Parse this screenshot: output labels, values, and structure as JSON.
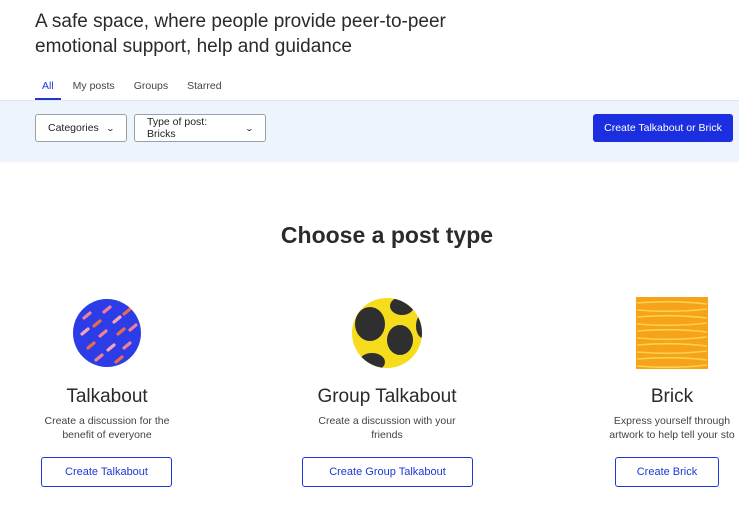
{
  "headline": "A safe space, where people provide peer-to-peer emotional support, help and guidance",
  "tabs": [
    {
      "label": "All",
      "active": true
    },
    {
      "label": "My posts",
      "active": false
    },
    {
      "label": "Groups",
      "active": false
    },
    {
      "label": "Starred",
      "active": false
    }
  ],
  "filters": {
    "categories_label": "Categories",
    "type_label": "Type of post: Bricks",
    "create_label": "Create Talkabout or Brick"
  },
  "chooser": {
    "title": "Choose a post type",
    "cards": [
      {
        "title": "Talkabout",
        "desc_line1": "Create a discussion for the",
        "desc_line2": "benefit of everyone",
        "button": "Create Talkabout",
        "icon": "talkabout-icon"
      },
      {
        "title": "Group Talkabout",
        "desc_line1": "Create a discussion with your",
        "desc_line2": "friends",
        "button": "Create Group Talkabout",
        "icon": "group-talkabout-icon"
      },
      {
        "title": "Brick",
        "desc_line1": "Express yourself through",
        "desc_line2": "artwork to help tell your sto",
        "button": "Create Brick",
        "icon": "brick-icon"
      }
    ]
  },
  "colors": {
    "primary": "#1c2fe0",
    "link": "#1c39d6",
    "filter_bg": "#eef4fc"
  }
}
